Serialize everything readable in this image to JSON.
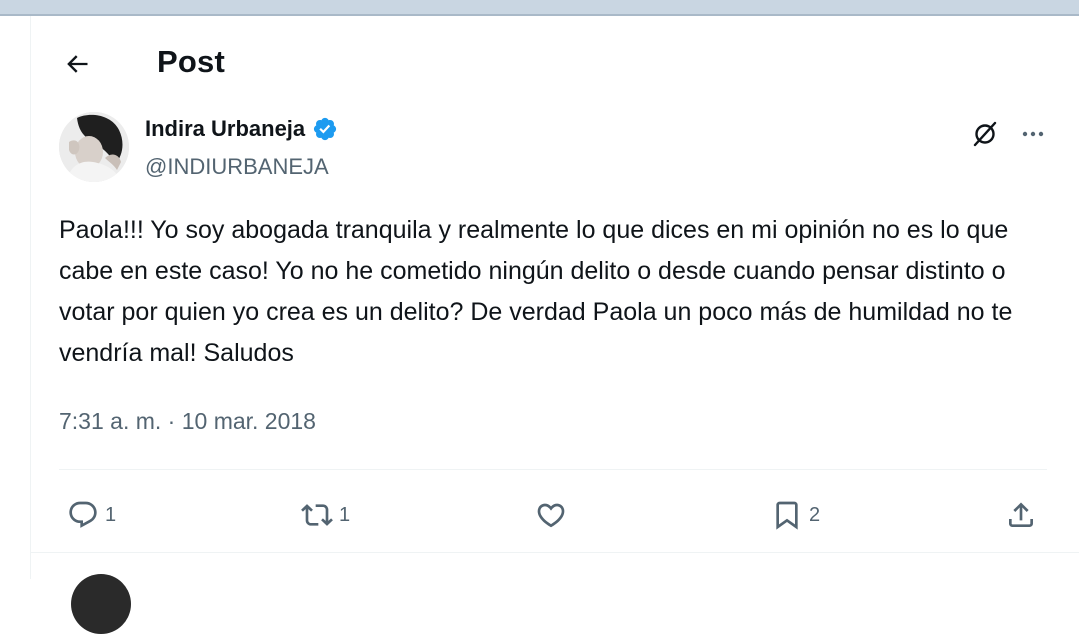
{
  "header": {
    "title": "Post"
  },
  "post": {
    "author_name": "Indira Urbaneja",
    "handle": "@INDIURBANEJA",
    "text": "Paola!!! Yo soy abogada tranquila y realmente lo que dices en mi opinión no es lo que cabe en este caso! Yo no he cometido ningún delito o desde cuando pensar distinto o votar por quien yo crea es un delito? De verdad Paola un poco más de humildad no te vendría mal! Saludos",
    "timestamp": "7:31 a. m. · 10 mar. 2018"
  },
  "actions": {
    "reply_count": "1",
    "repost_count": "1",
    "like_count": "",
    "bookmark_count": "2"
  },
  "icons": {
    "back": "arrow-left-icon",
    "verified": "verified-badge-icon",
    "grok": "grok-icon",
    "more": "more-horizontal-icon",
    "reply": "reply-icon",
    "repost": "repost-icon",
    "like": "heart-icon",
    "bookmark": "bookmark-icon",
    "share": "share-icon"
  },
  "colors": {
    "verified": "#1d9bf0",
    "secondary_text": "#536471",
    "primary_text": "#0f1419"
  }
}
